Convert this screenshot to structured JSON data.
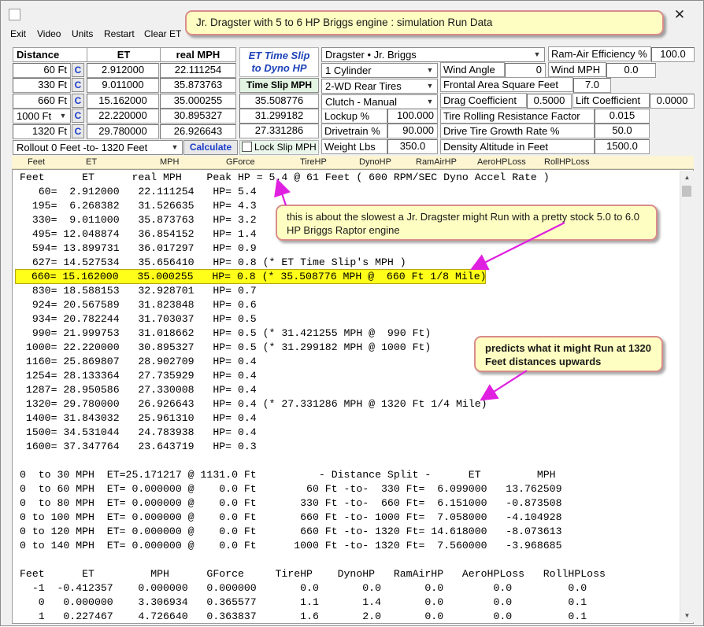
{
  "window": {
    "title_callout": "Jr. Dragster with 5 to 6 HP Briggs engine :  simulation Run Data",
    "close_glyph": "✕"
  },
  "menu": [
    "Exit",
    "Video",
    "Units",
    "Restart",
    "Clear ET"
  ],
  "table": {
    "headers": [
      "Distance",
      "ET",
      "real MPH"
    ],
    "rows": [
      {
        "dist": "60 Ft",
        "c": "C",
        "et": "2.912000",
        "mph": "22.111254"
      },
      {
        "dist": "330 Ft",
        "c": "C",
        "et": "9.011000",
        "mph": "35.873763"
      },
      {
        "dist": "660 Ft",
        "c": "C",
        "et": "15.162000",
        "mph": "35.000255"
      },
      {
        "dist": "1000 Ft",
        "c": "C",
        "et": "22.220000",
        "mph": "30.895327"
      },
      {
        "dist": "1320 Ft",
        "c": "C",
        "et": "29.780000",
        "mph": "26.926643"
      }
    ],
    "rollout_select": "Rollout 0 Feet -to- 1320 Feet",
    "calculate_label": "Calculate"
  },
  "et_slip": {
    "title_line1": "ET Time Slip",
    "title_line2": "to Dyno HP",
    "button_label": "Time Slip MPH",
    "values": [
      "35.508776",
      "31.299182",
      "27.331286"
    ],
    "lock_label": "Lock Slip MPH"
  },
  "config": {
    "vehicle": "Dragster • Jr. Briggs",
    "cylinders": "1  Cylinder",
    "drive": "2-WD Rear Tires",
    "clutch": "Clutch - Manual",
    "lockup_label": "Lockup %",
    "lockup_value": "100.000",
    "drivetrain_label": "Drivetrain %",
    "drivetrain_value": "90.000",
    "weight_label": "Weight Lbs",
    "weight_value": "350.0"
  },
  "params": {
    "wind_angle_label": "Wind Angle",
    "wind_angle_value": "0",
    "wind_mph_label": "Wind MPH",
    "wind_mph_value": "0.0",
    "ram_air_label": "Ram-Air Efficiency %",
    "ram_air_value": "100.0",
    "frontal_area_label": "Frontal Area Square Feet",
    "frontal_area_value": "7.0",
    "drag_coef_label": "Drag Coefficient",
    "drag_coef_value": "0.5000",
    "lift_coef_label": "Lift Coefficient",
    "lift_coef_value": "0.0000",
    "rolling_label": "Tire Rolling Resistance Factor",
    "rolling_value": "0.015",
    "growth_label": "Drive Tire Growth Rate %",
    "growth_value": "50.0",
    "density_label": "Density Altitude in Feet",
    "density_value": "1500.0"
  },
  "column_header": [
    "Feet",
    "ET",
    "MPH",
    "GForce",
    "TireHP",
    "DynoHP",
    "RamAirHP",
    "AeroHPLoss",
    "RollHPLoss"
  ],
  "output_text": "Feet      ET      real MPH    Peak HP = 5.4 @ 61 Feet ( 600 RPM/SEC Dyno Accel Rate )\n   60=  2.912000   22.111254   HP= 5.4\n  195=  6.268382   31.526635   HP= 4.3\n  330=  9.011000   35.873763   HP= 3.2\n  495= 12.048874   36.854152   HP= 1.4\n  594= 13.899731   36.017297   HP= 0.9\n  627= 14.527534   35.656410   HP= 0.8 (* ET Time Slip's MPH )\n  660= 15.162000   35.000255   HP= 0.8 (* 35.508776 MPH @  660 Ft 1/8 Mile)\n  830= 18.588153   32.928701   HP= 0.7\n  924= 20.567589   31.823848   HP= 0.6\n  934= 20.782244   31.703037   HP= 0.5\n  990= 21.999753   31.018662   HP= 0.5 (* 31.421255 MPH @  990 Ft)\n 1000= 22.220000   30.895327   HP= 0.5 (* 31.299182 MPH @ 1000 Ft)\n 1160= 25.869807   28.902709   HP= 0.4\n 1254= 28.133364   27.735929   HP= 0.4\n 1287= 28.950586   27.330008   HP= 0.4\n 1320= 29.780000   26.926643   HP= 0.4 (* 27.331286 MPH @ 1320 Ft 1/4 Mile)\n 1400= 31.843032   25.961310   HP= 0.4\n 1500= 34.531044   24.783938   HP= 0.4\n 1600= 37.347764   23.643719   HP= 0.3\n\n0  to 30 MPH  ET=25.171217 @ 1131.0 Ft          - Distance Split -      ET         MPH\n0  to 60 MPH  ET= 0.000000 @    0.0 Ft        60 Ft -to-  330 Ft=  6.099000   13.762509\n0  to 80 MPH  ET= 0.000000 @    0.0 Ft       330 Ft -to-  660 Ft=  6.151000   -0.873508\n0 to 100 MPH  ET= 0.000000 @    0.0 Ft       660 Ft -to- 1000 Ft=  7.058000   -4.104928\n0 to 120 MPH  ET= 0.000000 @    0.0 Ft       660 Ft -to- 1320 Ft= 14.618000   -8.073613\n0 to 140 MPH  ET= 0.000000 @    0.0 Ft      1000 Ft -to- 1320 Ft=  7.560000   -3.968685\n\nFeet      ET         MPH      GForce     TireHP    DynoHP   RamAirHP   AeroHPLoss   RollHPLoss\n  -1  -0.412357    0.000000   0.000000       0.0       0.0       0.0        0.0         0.0\n   0   0.000000    3.306934   0.365577       1.1       1.4       0.0        0.0         0.1\n   1   0.227467    4.726640   0.363837       1.6       2.0       0.0        0.0         0.1",
  "callouts": {
    "slowest": "this is about the slowest a Jr. Dragster might Run with a pretty stock 5.0 to 6.0 HP Briggs Raptor engine",
    "predicts": "predicts what it might Run at 1320 Feet distances upwards"
  },
  "colors": {
    "highlight": "#ffff1a",
    "callout_bg": "#fefec2",
    "callout_border": "#d98c8c",
    "arrow": "#e020e0",
    "button_blue": "#1a3ccb"
  }
}
